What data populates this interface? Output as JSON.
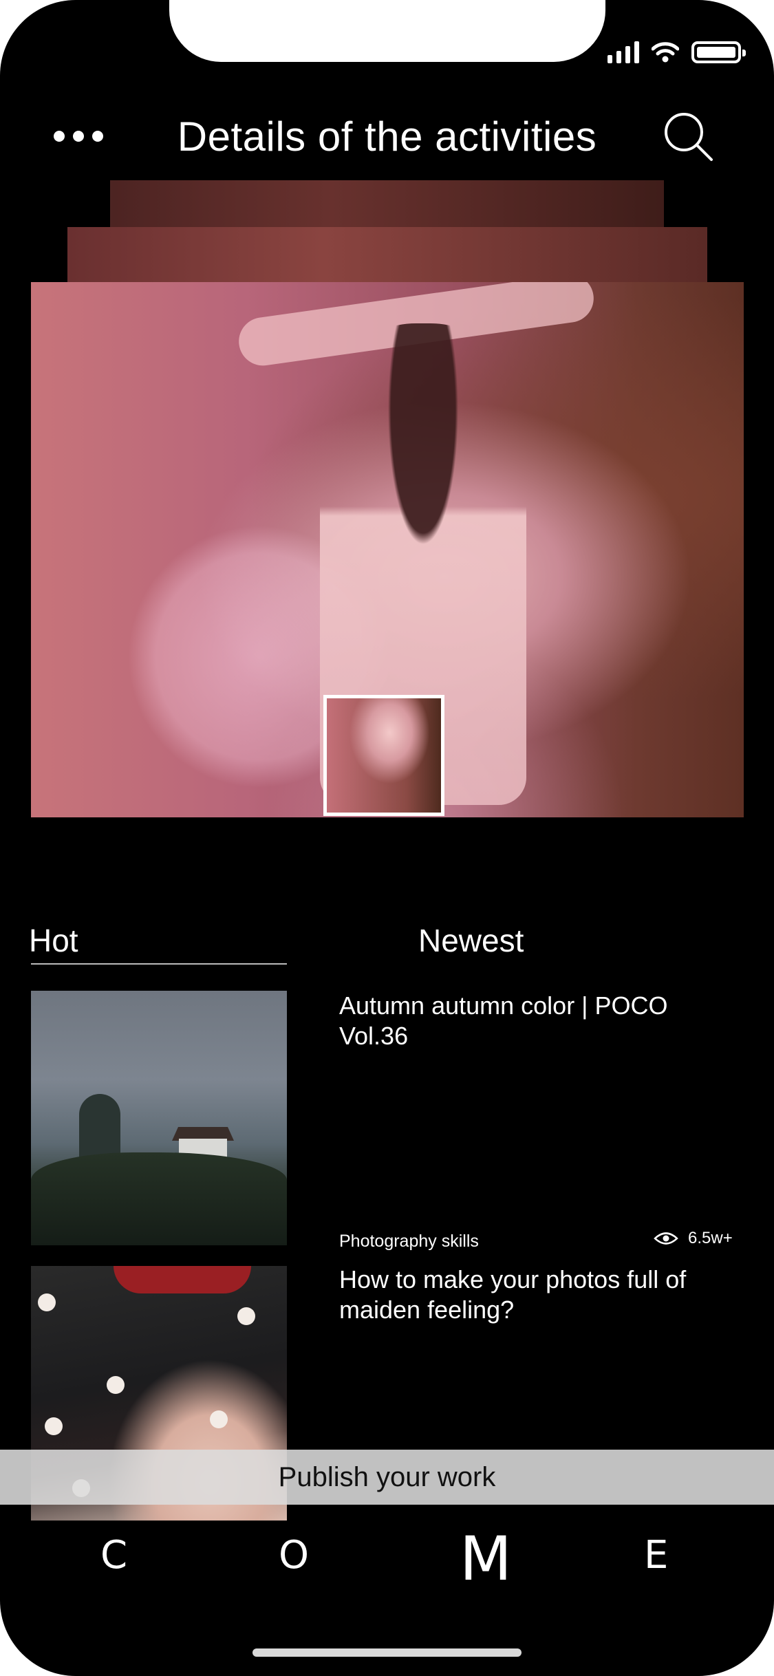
{
  "header": {
    "title": "Details of the activities",
    "more_icon": "more-horizontal-icon",
    "search_icon": "search-icon"
  },
  "status_bar": {
    "signal_icon": "cellular-signal-icon",
    "wifi_icon": "wifi-icon",
    "battery_icon": "battery-icon"
  },
  "tabs": [
    {
      "label": "Hot",
      "active": true
    },
    {
      "label": "Newest",
      "active": false
    }
  ],
  "articles": [
    {
      "title": "Autumn autumn color | POCO Vol.36",
      "category": "Photography skills",
      "views": "6.5w+"
    },
    {
      "title": "How to make your photos full of maiden feeling?"
    }
  ],
  "publish_label": "Publish your work",
  "bottom_nav": [
    "C",
    "O",
    "M",
    "E"
  ],
  "colors": {
    "background": "#000000",
    "text": "#ffffff",
    "publish_bar": "#dcdcdc"
  }
}
